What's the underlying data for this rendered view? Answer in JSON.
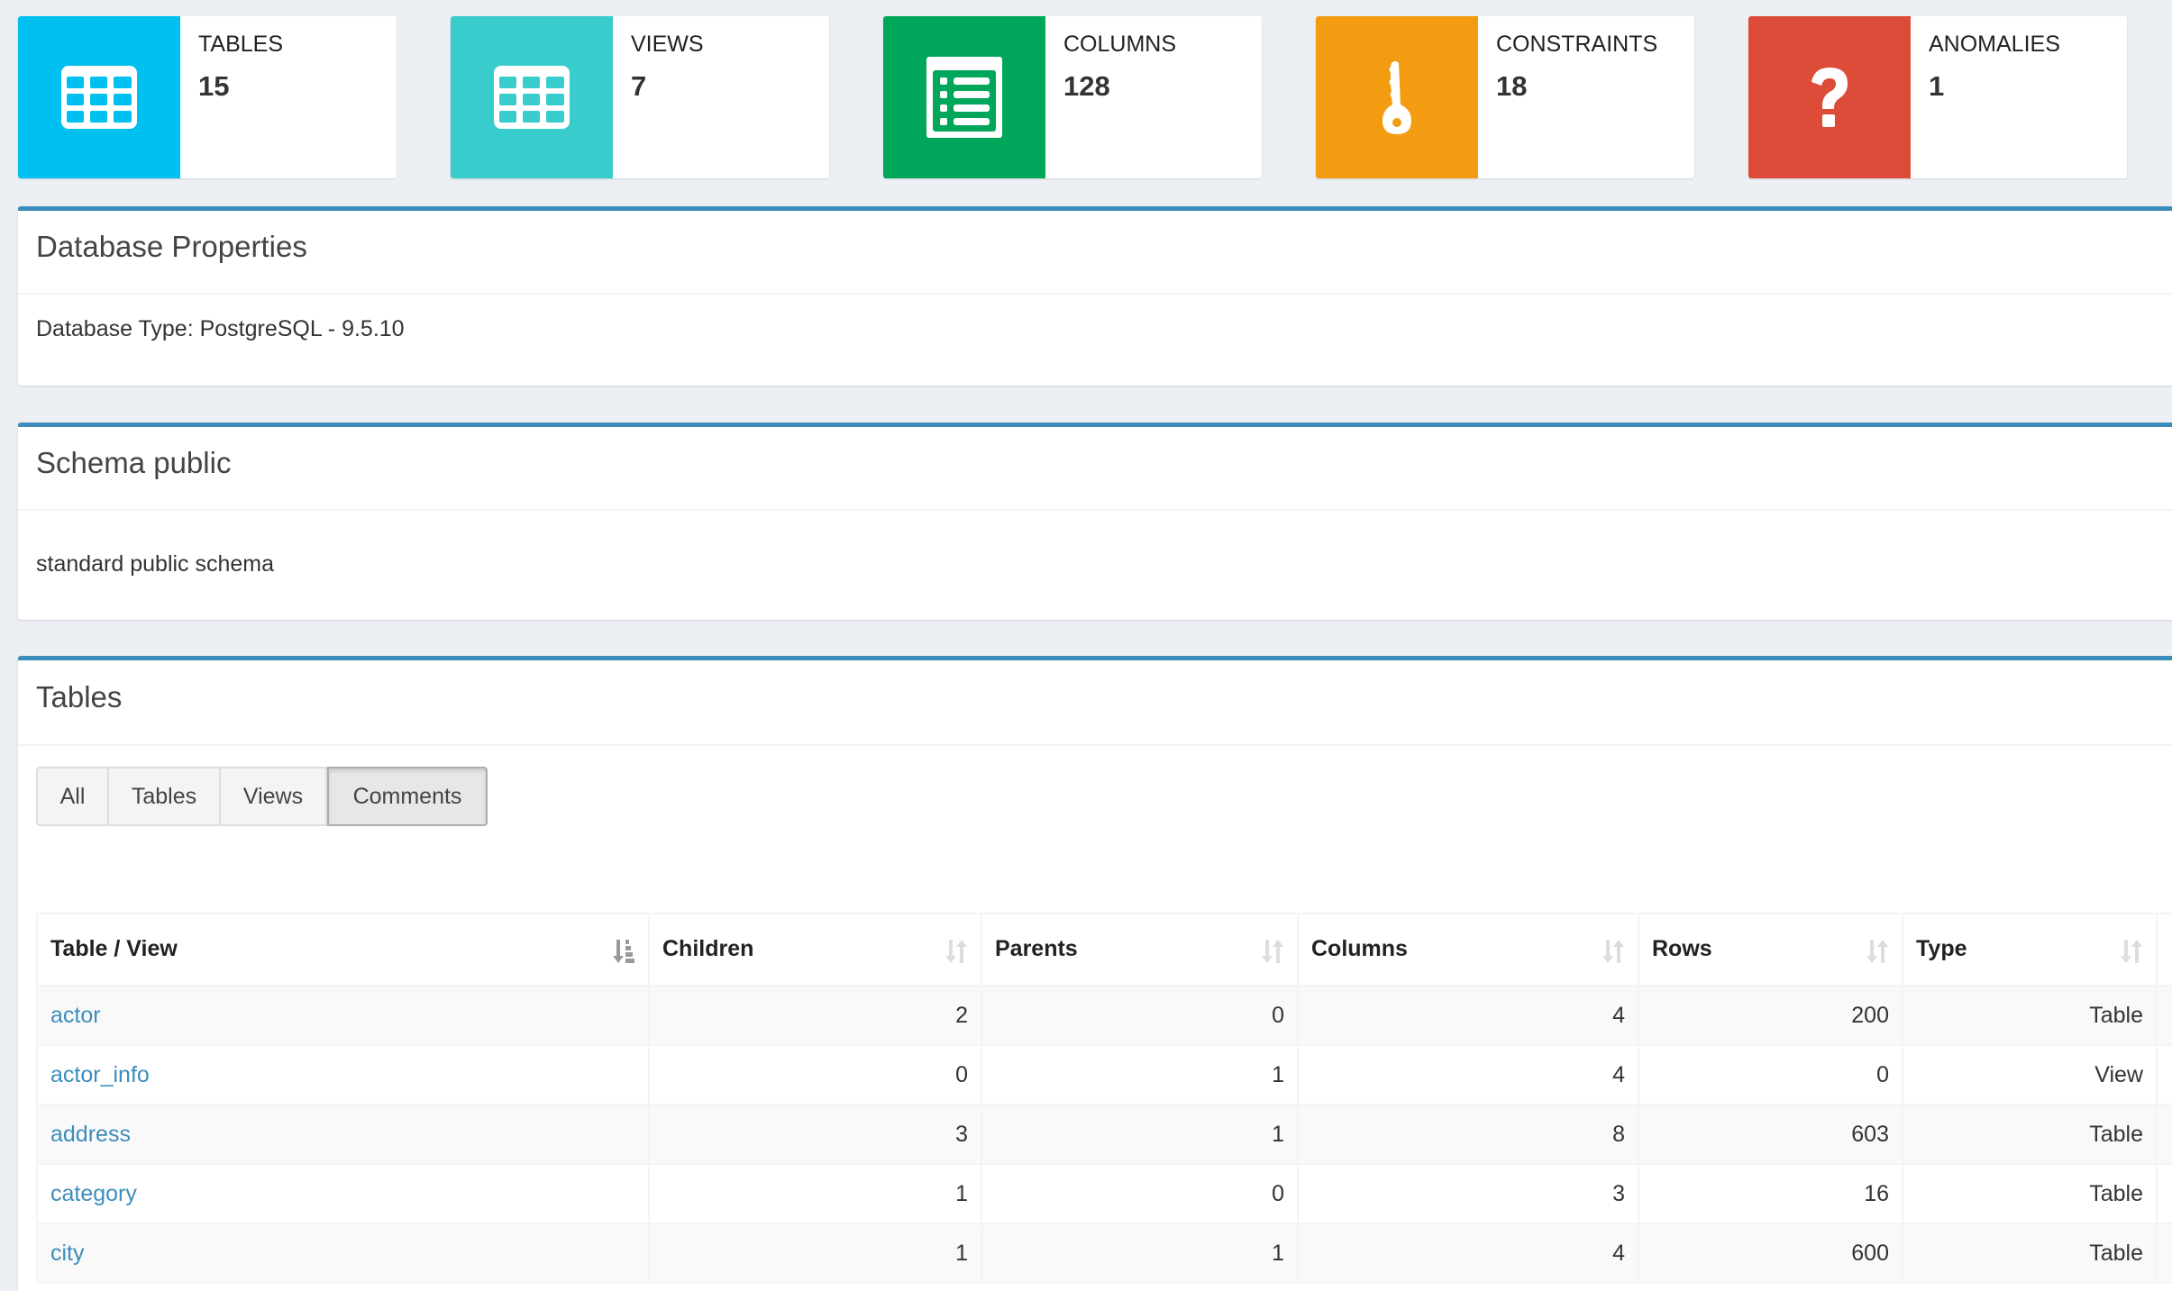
{
  "info_boxes": [
    {
      "label": "Tables",
      "value": "15",
      "icon": "table-icon",
      "color": "#00c0ef"
    },
    {
      "label": "Views",
      "value": "7",
      "icon": "table-icon",
      "color": "#39cccc"
    },
    {
      "label": "Columns",
      "value": "128",
      "icon": "list-alt-icon",
      "color": "#00a65a"
    },
    {
      "label": "Constraints",
      "value": "18",
      "icon": "key-icon",
      "color": "#f39c12"
    },
    {
      "label": "Anomalies",
      "value": "1",
      "icon": "question-icon",
      "color": "#dd4b39"
    }
  ],
  "database_properties": {
    "title": "Database Properties",
    "body": "Database Type: PostgreSQL - 9.5.10"
  },
  "schema": {
    "title": "Schema public",
    "body": "standard public schema"
  },
  "tables_box": {
    "title": "Tables",
    "filter_buttons": [
      {
        "label": "All",
        "active": false
      },
      {
        "label": "Tables",
        "active": false
      },
      {
        "label": "Views",
        "active": false
      },
      {
        "label": "Comments",
        "active": true
      }
    ],
    "columns": [
      {
        "label": "Table / View",
        "sort": "sorted-ascending"
      },
      {
        "label": "Children",
        "sort": "sortable"
      },
      {
        "label": "Parents",
        "sort": "sortable"
      },
      {
        "label": "Columns",
        "sort": "sortable"
      },
      {
        "label": "Rows",
        "sort": "sortable"
      },
      {
        "label": "Type",
        "sort": "sortable"
      },
      {
        "label": "",
        "sort": ""
      }
    ],
    "rows": [
      {
        "name": "actor",
        "children": "2",
        "parents": "0",
        "columns": "4",
        "rows": "200",
        "type": "Table"
      },
      {
        "name": "actor_info",
        "children": "0",
        "parents": "1",
        "columns": "4",
        "rows": "0",
        "type": "View"
      },
      {
        "name": "address",
        "children": "3",
        "parents": "1",
        "columns": "8",
        "rows": "603",
        "type": "Table"
      },
      {
        "name": "category",
        "children": "1",
        "parents": "0",
        "columns": "3",
        "rows": "16",
        "type": "Table"
      },
      {
        "name": "city",
        "children": "1",
        "parents": "1",
        "columns": "4",
        "rows": "600",
        "type": "Table"
      }
    ]
  },
  "colors": {
    "box_border": "#3c8dbc",
    "link": "#3c8dbc",
    "background": "#ecf0f5"
  }
}
